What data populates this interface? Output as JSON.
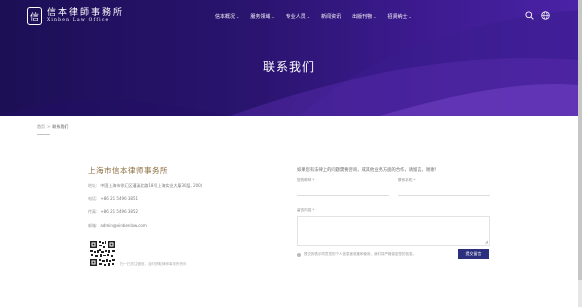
{
  "header": {
    "logo": {
      "mark": "信",
      "name_cn": "信本律師事務所",
      "name_en": "Xinben Law Office"
    },
    "nav": [
      {
        "label": "信本概况"
      },
      {
        "label": "服务领域"
      },
      {
        "label": "专业人员"
      },
      {
        "label": "新闻资讯"
      },
      {
        "label": "出版刊物"
      },
      {
        "label": "招贤纳士"
      }
    ],
    "search_icon": "search-icon",
    "language_icon": "globe-icon",
    "page_title": "联系我们"
  },
  "breadcrumb": {
    "home": "首页",
    "separator": ">",
    "current": "联系我们"
  },
  "contact": {
    "firm_name": "上海市信本律师事务所",
    "address_label": "地址:",
    "address": "中国上海市徐汇区漕溪北路18号上海实业大厦30层, 200(",
    "phone_label": "电话:",
    "phone": "+86 21 5496 3851",
    "fax_label": "传真:",
    "fax": "+86 21 5496 3852",
    "email_label": "邮箱:",
    "email": "admin@xinbenlaw.com",
    "qr_note": "扫一扫关注微信，及时获取律师事务所资讯"
  },
  "form": {
    "intro": "如果您有法律上的问题需要咨询，或其他业务方面的合作，请留言。谢谢！",
    "name_label": "您的称呼 *",
    "phone_label": "联系手机 *",
    "message_label": "留言内容 *",
    "privacy_text": "提交即表示同意您的个人信息被收集和使用，我们将严格保密您的信息。",
    "submit_label": "提交留言"
  },
  "colors": {
    "hero": "#2a1470",
    "accent_gold": "#8a6a3c",
    "button": "#2c2f7e"
  }
}
